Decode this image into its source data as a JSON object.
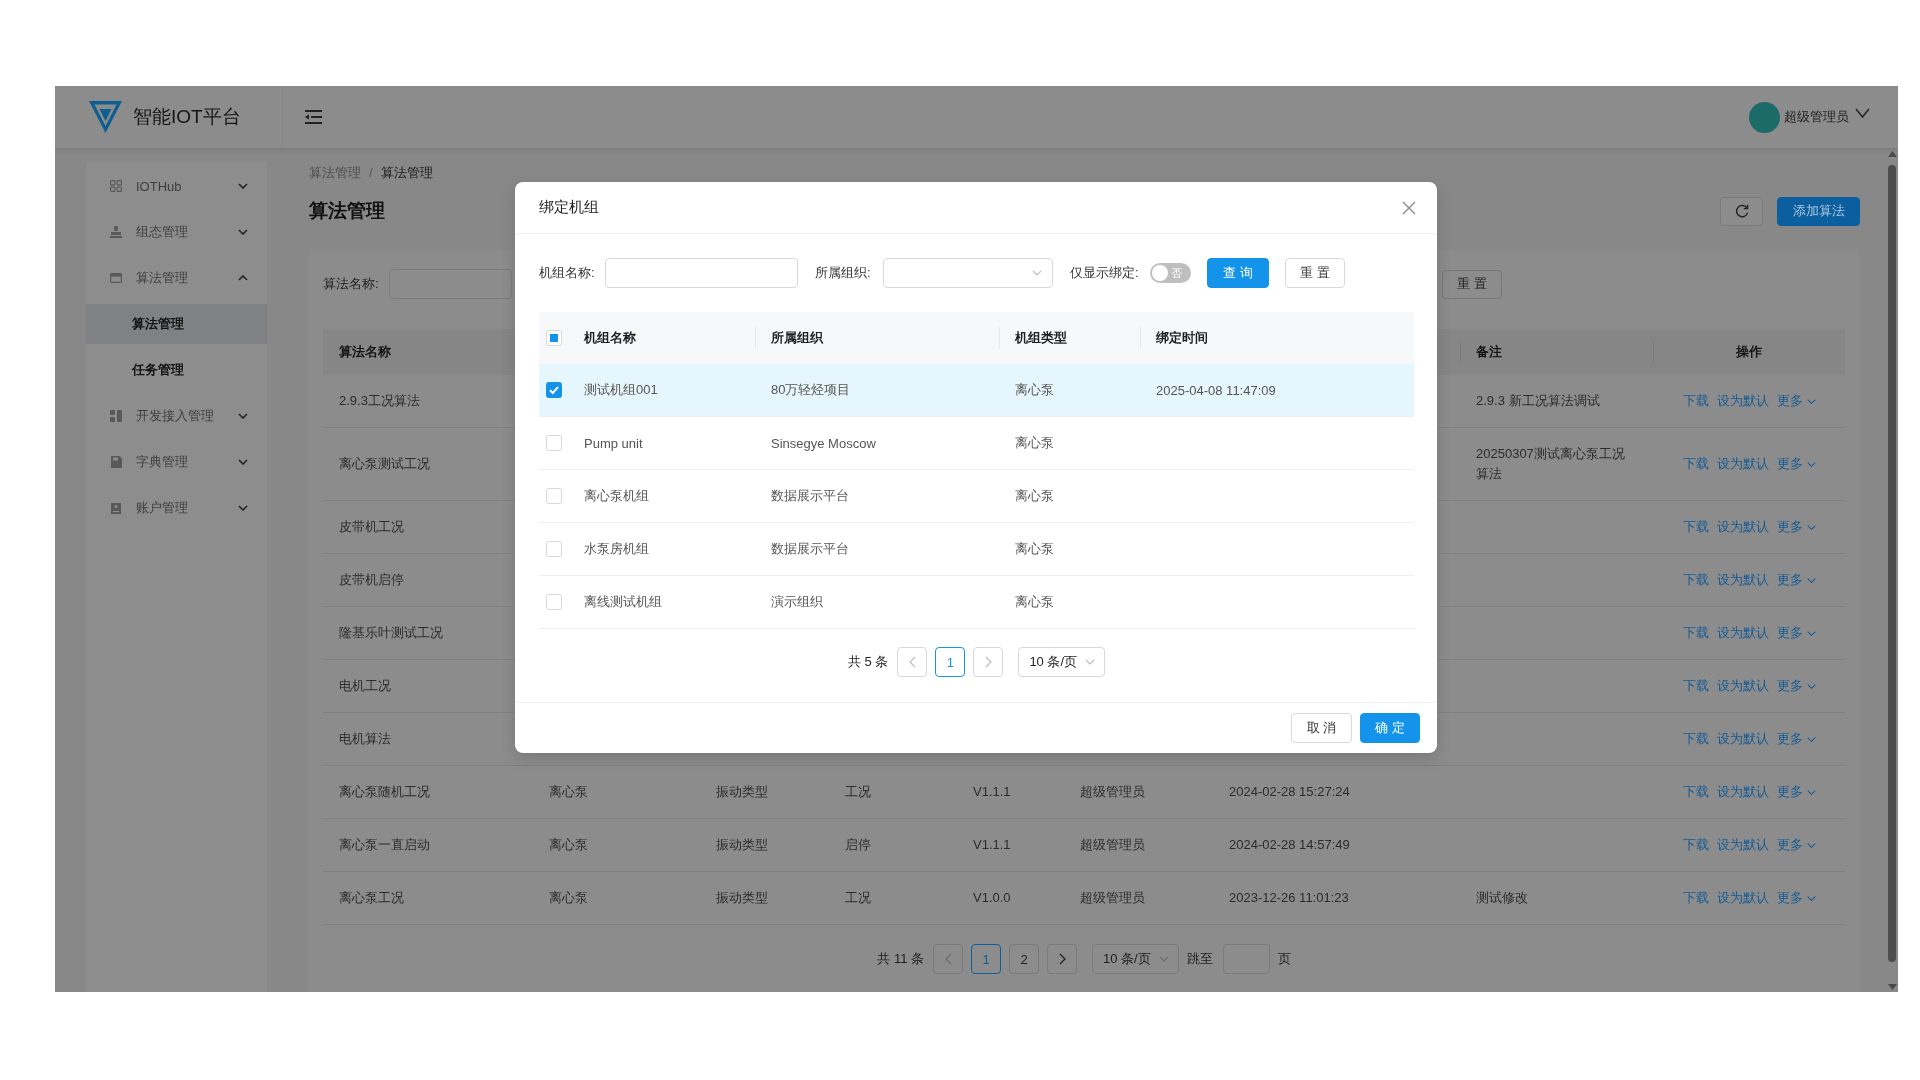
{
  "header": {
    "logo_text": "智能IOT平台",
    "user_name": "超级管理员"
  },
  "sidebar": {
    "items": [
      {
        "label": "IOTHub",
        "expanded": false
      },
      {
        "label": "组态管理",
        "expanded": false
      },
      {
        "label": "算法管理",
        "expanded": true,
        "children": [
          {
            "label": "算法管理",
            "selected": true
          },
          {
            "label": "任务管理",
            "selected": false
          }
        ]
      },
      {
        "label": "开发接入管理",
        "expanded": false
      },
      {
        "label": "字典管理",
        "expanded": false
      },
      {
        "label": "账户管理",
        "expanded": false
      }
    ]
  },
  "breadcrumb": {
    "items": [
      "算法管理",
      "算法管理"
    ],
    "separator": "/"
  },
  "page_title": "算法管理",
  "toolbar": {
    "add_button": "添加算法"
  },
  "search": {
    "label": "算法名称:",
    "reset_button": "重 置"
  },
  "table": {
    "columns": {
      "name": "算法名称",
      "remark": "备注",
      "actions": "操作"
    },
    "rows": [
      {
        "name": "2.9.3工况算法",
        "remark": "2.9.3 新工况算法调试",
        "actions": [
          "下载",
          "设为默认",
          "更多"
        ]
      },
      {
        "name": "离心泵测试工况",
        "remark": "20250307测试离心泵工况算法",
        "actions": [
          "下载",
          "设为默认",
          "更多"
        ]
      },
      {
        "name": "皮带机工况",
        "actions": [
          "下载",
          "设为默认",
          "更多"
        ]
      },
      {
        "name": "皮带机启停",
        "actions": [
          "下载",
          "设为默认",
          "更多"
        ]
      },
      {
        "name": "隆基乐叶测试工况",
        "actions": [
          "下载",
          "设为默认",
          "更多"
        ]
      },
      {
        "name": "电机工况",
        "actions": [
          "下载",
          "设为默认",
          "更多"
        ]
      },
      {
        "name": "电机算法",
        "actions": [
          "下载",
          "设为默认",
          "更多"
        ]
      },
      {
        "name": "离心泵随机工况",
        "column_2": "离心泵",
        "column_3": "振动类型",
        "column_4": "工况",
        "column_5": "V1.1.1",
        "column_6": "超级管理员",
        "column_7": "2024-02-28 15:27:24",
        "actions": [
          "下载",
          "设为默认",
          "更多"
        ]
      },
      {
        "name": "离心泵一直启动",
        "column_2": "离心泵",
        "column_3": "振动类型",
        "column_4": "启停",
        "column_5": "V1.1.1",
        "column_6": "超级管理员",
        "column_7": "2024-02-28 14:57:49",
        "actions": [
          "下载",
          "设为默认",
          "更多"
        ]
      },
      {
        "name": "离心泵工况",
        "column_2": "离心泵",
        "column_3": "振动类型",
        "column_4": "工况",
        "column_5": "V1.0.0",
        "column_6": "超级管理员",
        "column_7": "2023-12-26 11:01:23",
        "remark": "测试修改",
        "actions": [
          "下载",
          "设为默认",
          "更多"
        ]
      }
    ]
  },
  "pagination": {
    "total": "共 11 条",
    "prev_disabled": true,
    "next_disabled": false,
    "pages": [
      {
        "label": "1",
        "selected": true
      },
      {
        "label": "2",
        "selected": false
      }
    ],
    "page_size": "10 条/页",
    "jump_label": "跳至",
    "jump_suffix": "页"
  },
  "modal": {
    "title": "绑定机组",
    "filters": {
      "name_label": "机组名称:",
      "org_label": "所属组织:",
      "bound_only": {
        "label": "仅显示绑定:",
        "on": false,
        "switch_text": "否"
      },
      "query_button": "查 询",
      "reset_button": "重 置"
    },
    "table": {
      "select_all": {
        "checked": false,
        "indeterminate": true
      },
      "columns": [
        "机组名称",
        "所属组织",
        "机组类型",
        "绑定时间"
      ],
      "rows": [
        {
          "selected": true,
          "cells": [
            "测试机组001",
            "80万轻烃项目",
            "离心泵",
            "2025-04-08 11:47:09"
          ]
        },
        {
          "selected": false,
          "cells": [
            "Pump unit",
            "Sinsegye Moscow",
            "离心泵"
          ]
        },
        {
          "selected": false,
          "cells": [
            "离心泵机组",
            "数据展示平台",
            "离心泵"
          ]
        },
        {
          "selected": false,
          "cells": [
            "水泵房机组",
            "数据展示平台",
            "离心泵"
          ]
        },
        {
          "selected": false,
          "cells": [
            "离线测试机组",
            "演示组织",
            "离心泵"
          ]
        }
      ]
    },
    "pagination": {
      "total": "共 5 条",
      "prev_disabled": true,
      "next_disabled": true,
      "pages": [
        {
          "label": "1",
          "selected": true
        }
      ],
      "page_size": "10 条/页"
    },
    "buttons": {
      "cancel": "取 消",
      "ok": "确 定"
    }
  }
}
